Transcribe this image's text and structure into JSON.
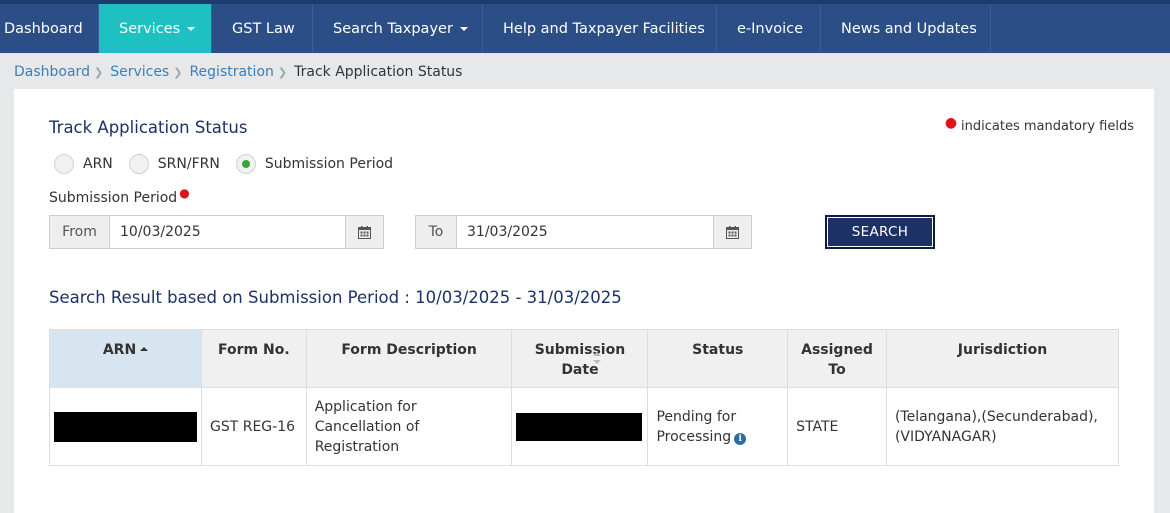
{
  "nav": {
    "items": [
      {
        "label": "Dashboard",
        "dropdown": false,
        "active": false
      },
      {
        "label": "Services",
        "dropdown": true,
        "active": true
      },
      {
        "label": "GST Law",
        "dropdown": false,
        "active": false
      },
      {
        "label": "Search Taxpayer",
        "dropdown": true,
        "active": false
      },
      {
        "label": "Help and Taxpayer Facilities",
        "dropdown": false,
        "active": false
      },
      {
        "label": "e-Invoice",
        "dropdown": false,
        "active": false
      },
      {
        "label": "News and Updates",
        "dropdown": false,
        "active": false
      }
    ]
  },
  "breadcrumb": {
    "items": [
      "Dashboard",
      "Services",
      "Registration"
    ],
    "current": "Track Application Status"
  },
  "form": {
    "title": "Track Application Status",
    "mandatory_note": "indicates mandatory fields",
    "radio_options": [
      "ARN",
      "SRN/FRN",
      "Submission Period"
    ],
    "selected_option": "Submission Period",
    "period_label": "Submission Period",
    "from_label": "From",
    "from_value": "10/03/2025",
    "to_label": "To",
    "to_value": "31/03/2025",
    "search_label": "SEARCH"
  },
  "results": {
    "title": "Search Result based on Submission Period : 10/03/2025 - 31/03/2025",
    "columns": [
      "ARN",
      "Form No.",
      "Form Description",
      "Submission Date",
      "Status",
      "Assigned To",
      "Jurisdiction"
    ],
    "rows": [
      {
        "arn": "",
        "form_no": "GST REG-16",
        "form_description": "Application for Cancellation of Registration",
        "submission_date": "",
        "status": "Pending for Processing",
        "assigned_to": "STATE",
        "jurisdiction": "(Telangana),(Secunderabad),(VIDYANAGAR)"
      }
    ]
  },
  "colors": {
    "nav_bg": "#2c4e86",
    "nav_active": "#1fc0c1",
    "title_color": "#1c3166",
    "link_color": "#3a7fb8",
    "required_red": "#e0121a"
  }
}
